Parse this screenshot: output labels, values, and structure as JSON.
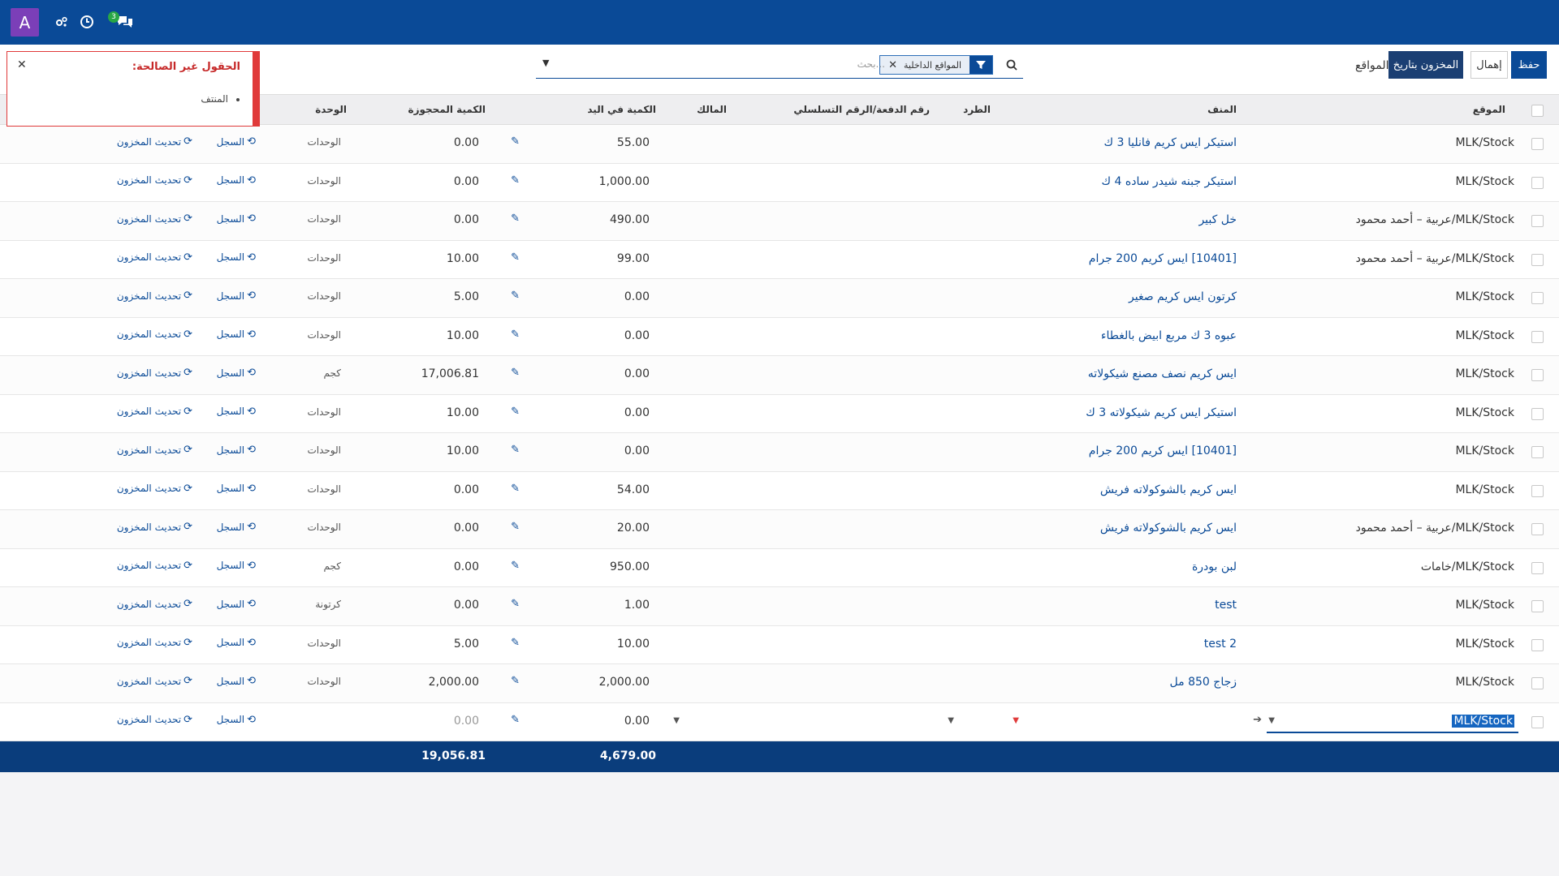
{
  "topbar": {
    "avatar_letter": "A",
    "messages_badge": "3"
  },
  "controls": {
    "save_label": "حفظ",
    "discard_label": "إهمال",
    "stock_date_label": "المخزون بتاريخ",
    "locations_label": "المواقع"
  },
  "search": {
    "facet_label": "المواقع الداخلية",
    "placeholder": "بحث..."
  },
  "error": {
    "title": "الحقول غير الصالحة:",
    "items": [
      "المنتف"
    ]
  },
  "columns": {
    "location": "الموقع",
    "product": "المنف",
    "package": "الطرد",
    "lot": "رقم الدفعة/الرقم التسلسلي",
    "owner": "المالك",
    "on_hand": "الكمية في اليد",
    "reserved": "الكمية المحجوزة",
    "unit": "الوحدة"
  },
  "actions": {
    "history": "السجل",
    "update": "تحديث المخزون"
  },
  "rows": [
    {
      "location": "MLK/Stock",
      "product": "استيكر ايس كريم فانليا 3 ك",
      "on_hand": "55.00",
      "reserved": "0.00",
      "unit": "الوحدات"
    },
    {
      "location": "MLK/Stock",
      "product": "استيكر جبنه شيدر ساده 4 ك",
      "on_hand": "1,000.00",
      "reserved": "0.00",
      "unit": "الوحدات"
    },
    {
      "location": "MLK/Stock/عربية – أحمد محمود",
      "product": "خل كبير",
      "on_hand": "490.00",
      "reserved": "0.00",
      "unit": "الوحدات"
    },
    {
      "location": "MLK/Stock/عربية – أحمد محمود",
      "product": "[10401] ايس كريم 200 جرام",
      "on_hand": "99.00",
      "reserved": "10.00",
      "unit": "الوحدات"
    },
    {
      "location": "MLK/Stock",
      "product": "كرتون ايس كريم صغير",
      "on_hand": "0.00",
      "reserved": "5.00",
      "unit": "الوحدات"
    },
    {
      "location": "MLK/Stock",
      "product": "عبوه 3 ك مربع ابيض بالغطاء",
      "on_hand": "0.00",
      "reserved": "10.00",
      "unit": "الوحدات"
    },
    {
      "location": "MLK/Stock",
      "product": "ايس كريم نصف مصنع شيكولاته",
      "on_hand": "0.00",
      "reserved": "17,006.81",
      "unit": "كجم"
    },
    {
      "location": "MLK/Stock",
      "product": "استيكر ايس كريم شيكولاته 3 ك",
      "on_hand": "0.00",
      "reserved": "10.00",
      "unit": "الوحدات"
    },
    {
      "location": "MLK/Stock",
      "product": "[10401] ايس كريم 200 جرام",
      "on_hand": "0.00",
      "reserved": "10.00",
      "unit": "الوحدات"
    },
    {
      "location": "MLK/Stock",
      "product": "ايس كريم بالشوكولاته فريش",
      "on_hand": "54.00",
      "reserved": "0.00",
      "unit": "الوحدات"
    },
    {
      "location": "MLK/Stock/عربية – أحمد محمود",
      "product": "ايس كريم بالشوكولاته فريش",
      "on_hand": "20.00",
      "reserved": "0.00",
      "unit": "الوحدات"
    },
    {
      "location": "MLK/Stock/خامات",
      "product": "لبن بودرة",
      "on_hand": "950.00",
      "reserved": "0.00",
      "unit": "كجم"
    },
    {
      "location": "MLK/Stock",
      "product": "test",
      "on_hand": "1.00",
      "reserved": "0.00",
      "unit": "كرتونة"
    },
    {
      "location": "MLK/Stock",
      "product": "test 2",
      "on_hand": "10.00",
      "reserved": "5.00",
      "unit": "الوحدات"
    },
    {
      "location": "MLK/Stock",
      "product": "زجاج 850 مل",
      "on_hand": "2,000.00",
      "reserved": "2,000.00",
      "unit": "الوحدات"
    }
  ],
  "edit_row": {
    "location": "MLK/Stock",
    "on_hand": "0.00",
    "reserved": "0.00"
  },
  "totals": {
    "on_hand": "4,679.00",
    "reserved": "19,056.81"
  }
}
